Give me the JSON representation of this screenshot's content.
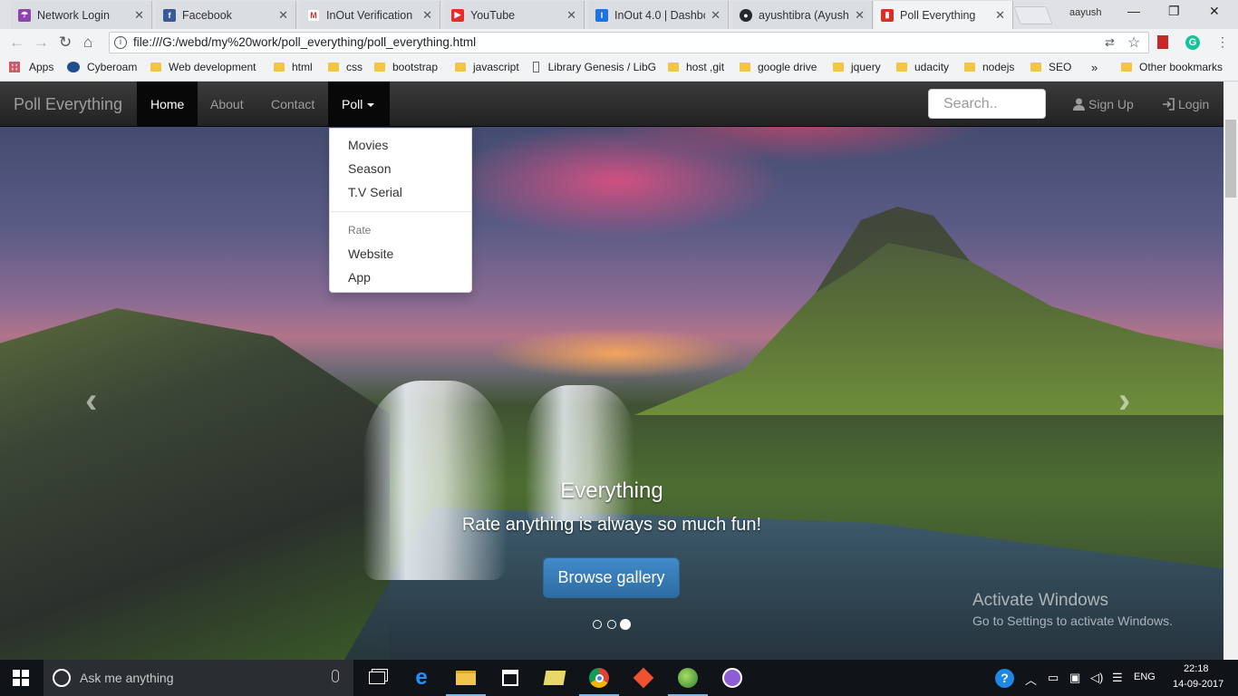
{
  "browser": {
    "tabs": [
      {
        "title": "Network Login",
        "favicon_color": "#8e44ad"
      },
      {
        "title": "Facebook",
        "favicon_color": "#3b5998"
      },
      {
        "title": "InOut Verification",
        "favicon_color": "#d93025"
      },
      {
        "title": "YouTube",
        "favicon_color": "#e52d27"
      },
      {
        "title": "InOut 4.0 | Dashbo",
        "favicon_color": "#1a73e8"
      },
      {
        "title": "ayushtibra (Ayush",
        "favicon_color": "#24292e"
      },
      {
        "title": "Poll Everything",
        "favicon_color": "#d93025"
      }
    ],
    "profile_name": "aayush",
    "address": "file:///G:/webd/my%20work/poll_everything/poll_everything.html",
    "bookmarks": [
      "Apps",
      "Cyberoam",
      "Web development",
      "html",
      "css",
      "bootstrap",
      "javascript",
      "Library Genesis / LibG",
      "host ,git",
      "google drive",
      "jquery",
      "udacity",
      "nodejs",
      "SEO",
      "»",
      "Other bookmarks"
    ]
  },
  "navbar": {
    "brand": "Poll Everything",
    "links": [
      "Home",
      "About",
      "Contact",
      "Poll"
    ],
    "search_placeholder": "Search..",
    "signup": "Sign Up",
    "login": "Login"
  },
  "dropdown": {
    "items": [
      "Movies",
      "Season",
      "T.V Serial"
    ],
    "header": "Rate",
    "rate_items": [
      "Website",
      "App"
    ]
  },
  "carousel": {
    "title": "Everything",
    "subtitle": "Rate anything is always so much fun!",
    "button": "Browse gallery",
    "active_index": 2,
    "prev_glyph": "‹",
    "next_glyph": "›"
  },
  "watermark": {
    "line1": "Activate Windows",
    "line2": "Go to Settings to activate Windows."
  },
  "taskbar": {
    "search_text": "Ask me anything",
    "language": "ENG",
    "time": "22:18",
    "date": "14-09-2017"
  }
}
